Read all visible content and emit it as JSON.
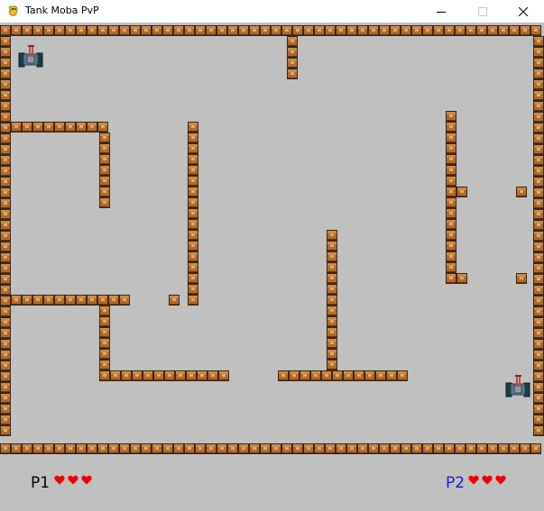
{
  "window": {
    "title": "Tank Moba PvP",
    "app_icon": "pygame-snake-icon",
    "controls": {
      "minimize": "minimize-icon",
      "maximize": "maximize-icon",
      "close": "close-icon"
    }
  },
  "game": {
    "background_color": "#c0c0c0",
    "wall_color": "#b06a2c",
    "players": [
      {
        "label": "P1",
        "label_color": "#000000",
        "lives": 3,
        "heart_color": "#ee0000",
        "tank_icon": "tank-icon"
      },
      {
        "label": "P2",
        "label_color": "#1a1acc",
        "lives": 3,
        "heart_color": "#ee0000",
        "tank_icon": "tank-icon"
      }
    ]
  }
}
